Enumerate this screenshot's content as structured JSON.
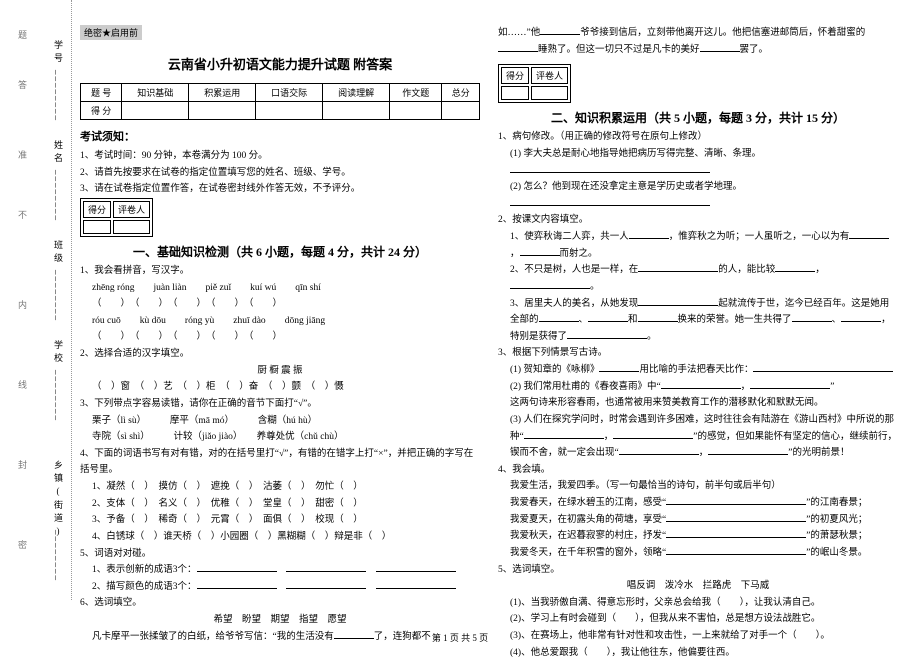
{
  "gutter": {
    "fields": [
      "学号",
      "姓名",
      "班级",
      "学校",
      "乡镇(街道)"
    ],
    "bars": [
      "题",
      "答",
      "准",
      "不",
      "内",
      "线",
      "封",
      "密"
    ]
  },
  "seal": "绝密★启用前",
  "title": "云南省小升初语文能力提升试题 附答案",
  "score_headers": [
    "题 号",
    "知识基础",
    "积累运用",
    "口语交际",
    "阅读理解",
    "作文题",
    "总分"
  ],
  "score_row2": "得 分",
  "notice_head": "考试须知：",
  "notices": [
    "1、考试时间：90 分钟，本卷满分为 100 分。",
    "2、请首先按要求在试卷的指定位置填写您的姓名、班级、学号。",
    "3、请在试卷指定位置作答，在试卷密封线外作答无效，不予评分。"
  ],
  "scorebox": {
    "c1": "得分",
    "c2": "评卷人"
  },
  "sec1_title": "一、基础知识检测（共 6 小题，每题 4 分，共计 24 分）",
  "q1": {
    "stem": "1、我会看拼音，写汉字。",
    "row1": [
      "zhēng róng",
      "juàn liàn",
      "piě zuǐ",
      "kuí wú",
      "qīn shí"
    ],
    "row2": [
      "róu cuō",
      "kù dōu",
      "róng yù",
      "zhuī dào",
      "dōng jiāng"
    ]
  },
  "q2": {
    "stem": "2、选择合适的汉字填空。",
    "chars": "厨   橱   震   振",
    "line": "（　）窗　（　）艺　（　）柜　（　）奋　（　）颤　（　）慑"
  },
  "q3": {
    "stem": "3、下列带点字容易读错，请你在正确的音节下面打“√”。",
    "l1": "栗子（lì sù）　　　摩平（mā mó）　　　含糊（hú hù）",
    "l2": "寺院（sì shì）　　　计较（jiǎo jiào）　　养尊处优（chǔ chù）"
  },
  "q4": {
    "stem": "4、下面的词语书写有对有错，对的在括号里打“√”，有错的在错字上打“×”，并把正确的字写在括号里。",
    "l1": "1、凝然（　）　摸仿（　）　遮挽（　）　沽萎（　）　勿忙（　）",
    "l2": "2、支体（　）　名义（　）　优稚（　）　堂皇（　）　甜密（　）",
    "l3": "3、予备（　）　稀奇（　）　元霄（　）　面俱（　）　校现（　）",
    "l4": "4、白锈球（　）谁天桥（　）小园圈（　）黑糊糊（　）辩是非（　）"
  },
  "q5": {
    "stem": "5、词语对对碰。",
    "l1": "1、表示创新的成语3个：",
    "l2": "2、描写颜色的成语3个："
  },
  "q6": {
    "stem": "6、选词填空。",
    "opts": "希望　盼望　期望　指望　愿望",
    "body": "凡卡摩平一张揉皱了的白纸，给爷爷写信：“我的生活没有______了，连狗都不如……”他______爷爷接到信后，立刻带他离开这儿。他把信塞进邮筒后，怀着甜蜜的______睡熟了。但这一切只不过是凡卡的美好______罢了。"
  },
  "sec2_title": "二、知识积累运用（共 5 小题，每题 3 分，共计 15 分）",
  "p1": {
    "stem": "1、病句修改。（用正确的修改符号在原句上修改）",
    "l1": "(1) 李大夫总是耐心地指导她把病历写得完整、清晰、条理。",
    "l2": "(2) 怎么？他到现在还没拿定主意是学历史或者学地理。"
  },
  "p2": {
    "stem": "2、按课文内容填空。",
    "l1": "1、使弈秋诲二人弈，共一人______，惟弈秋之为听；一人虽听之，一心以为有______，______而射之。",
    "l2": "2、不只是树，人也是一样，在______的人，能比较______，______。",
    "l3": "3、居里夫人的美名，从她发现______起就流传于世，迄今已经百年。这是她用全部的______、______和______换来的荣誉。她一生共得了______、______，特别是获得了______。"
  },
  "p3": {
    "stem": "3、根据下列情景写古诗。",
    "l1": "(1) 贺知章的《咏柳》______用比喻的手法把春天比作：",
    "l2": "(2) 我们常用杜甫的《春夜喜雨》中“______，______”",
    "l3": "这两句诗来形容春雨，也通常被用来赞美教育工作的潜移默化和默默无闻。",
    "l4": "(3) 人们在探究学问时，时常会遇到许多困难，这时往往会有陆游在《游山西村》中所说的那种“______，______”的感觉，但如果能怀有坚定的信心，继续前行，锲而不舍，就一定会出现“______，______”的光明前景！"
  },
  "p4": {
    "stem": "4、我会填。",
    "l0": "我爱生活，我爱四季。（写一句最恰当的诗句，前半句或后半句）",
    "l1": "我爱春天，在绿水碧玉的江南，感受“______”的江南春景；",
    "l2": "我爱夏天，在初露头角的荷塘，享受“______”的初夏风光；",
    "l3": "我爱秋天，在迟暮寂寥的村庄，抒发“______”的萧瑟秋景；",
    "l4": "我爱冬天，在千年积雪的窗外，领略“______”的岷山冬景。"
  },
  "p5": {
    "stem": "5、选词填空。",
    "opts": "唱反调　泼冷水　拦路虎　下马威",
    "l1": "(1)、当我骄傲自满、得意忘形时，父亲总会给我（　　），让我认清自己。",
    "l2": "(2)、学习上有时会碰到（　　），但我从来不害怕，总是想方设法战胜它。",
    "l3": "(3)、在赛场上，他非常有针对性和攻击性，一上来就给了对手一个（　　）。",
    "l4": "(4)、他总爱跟我（　　），我让他往东，他偏要往西。"
  },
  "footer": "第 1 页 共 5 页"
}
